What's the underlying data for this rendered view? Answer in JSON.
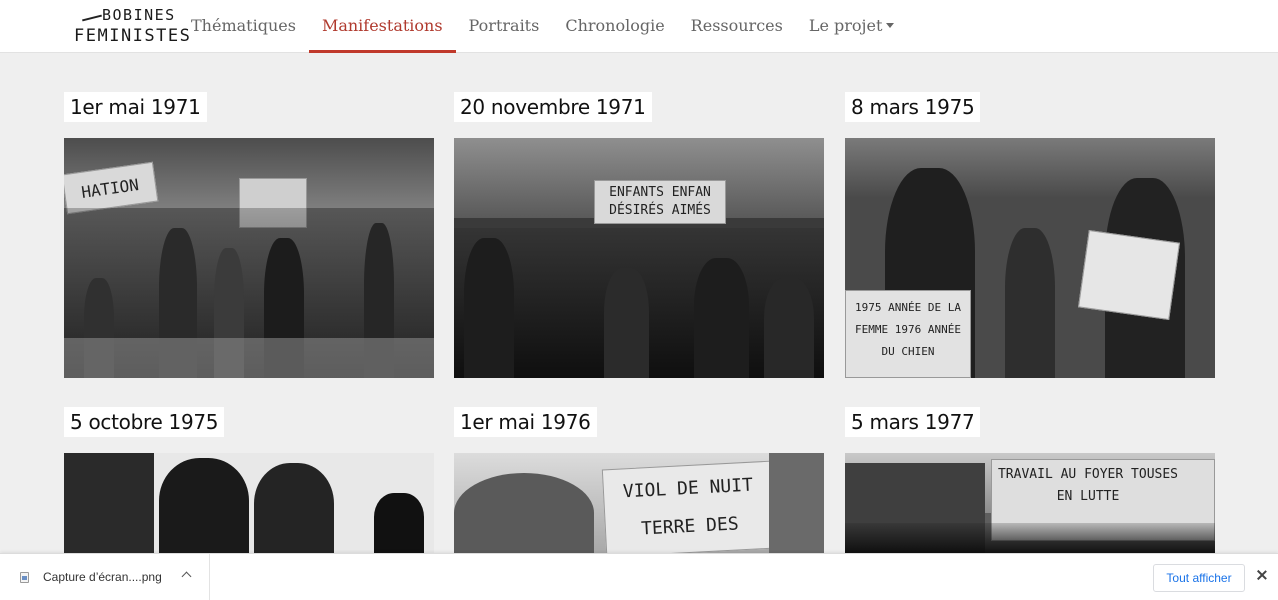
{
  "nav": {
    "logo_line1": "BOBINES",
    "logo_line2": "FEMINISTES",
    "items": [
      {
        "label": "Thématiques"
      },
      {
        "label": "Manifestations"
      },
      {
        "label": "Portraits"
      },
      {
        "label": "Chronologie"
      },
      {
        "label": "Ressources"
      },
      {
        "label": "Le projet"
      }
    ],
    "active": "Manifestations"
  },
  "cards": [
    {
      "title": "1er mai 1971",
      "banner": "HATION"
    },
    {
      "title": "20 novembre 1971",
      "banner": "ENFANTS ENFAN DÉSIRÉS AIMÉS"
    },
    {
      "title": "8 mars 1975",
      "banner": "1975 ANNÉE DE LA FEMME 1976 ANNÉE DU CHIEN"
    },
    {
      "title": "5 octobre 1975",
      "banner": ""
    },
    {
      "title": "1er mai 1976",
      "banner": "VIOL DE NUIT TERRE DES HOMMES"
    },
    {
      "title": "5 mars 1977",
      "banner": "TRAVAIL AU FOYER TOUSES EN LUTTE"
    }
  ],
  "downloads": {
    "file_name": "Capture d’écran....png",
    "show_all_label": "Tout afficher"
  },
  "colors": {
    "accent": "#c0392b",
    "background": "#efefef"
  }
}
